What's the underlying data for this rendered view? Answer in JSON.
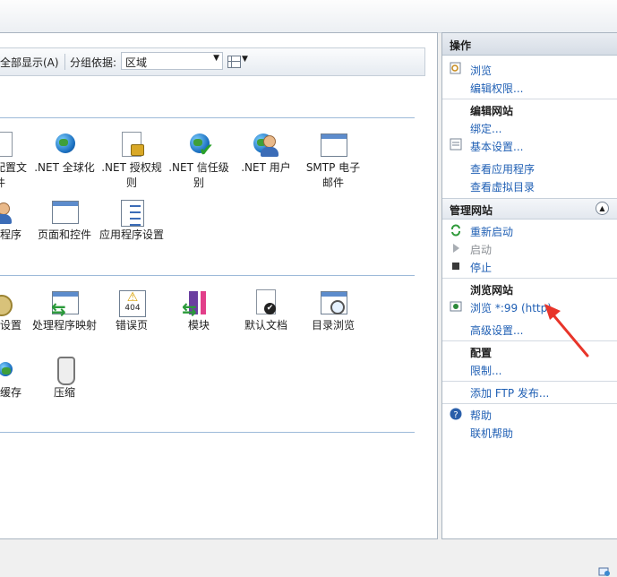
{
  "toolbar": {
    "show_all": "全部显示(A)",
    "group_by_label": "分组依据:",
    "group_by_value": "区域"
  },
  "features": [
    {
      "label": "配置文件",
      "icon": "config-file-icon"
    },
    {
      "label": ".NET 全球化",
      "icon": "globe-icon"
    },
    {
      "label": ".NET 授权规则",
      "icon": "lock-icon"
    },
    {
      "label": ".NET 信任级别",
      "icon": "trust-check-icon"
    },
    {
      "label": ".NET 用户",
      "icon": "users-icon"
    },
    {
      "label": "SMTP 电子邮件",
      "icon": "email-icon"
    },
    {
      "label": "程序",
      "icon": "user-program-icon"
    },
    {
      "label": "页面和控件",
      "icon": "pages-controls-icon"
    },
    {
      "label": "应用程序设置",
      "icon": "app-settings-icon"
    },
    {
      "label": "设置",
      "icon": "settings-icon"
    },
    {
      "label": "处理程序映射",
      "icon": "handler-mapping-icon"
    },
    {
      "label": "错误页",
      "icon": "error-page-icon"
    },
    {
      "label": "模块",
      "icon": "modules-icon"
    },
    {
      "label": "默认文档",
      "icon": "default-document-icon"
    },
    {
      "label": "目录浏览",
      "icon": "directory-browse-icon"
    },
    {
      "label": "缓存",
      "icon": "cache-icon"
    },
    {
      "label": "压缩",
      "icon": "compression-icon"
    }
  ],
  "actions": {
    "title": "操作",
    "browse": "浏览",
    "edit_permissions": "编辑权限...",
    "edit_site_heading": "编辑网站",
    "bindings": "绑定...",
    "basic_settings": "基本设置...",
    "view_applications": "查看应用程序",
    "view_virtual_dirs": "查看虚拟目录",
    "manage_site_heading": "管理网站",
    "restart": "重新启动",
    "start": "启动",
    "stop": "停止",
    "browse_site_heading": "浏览网站",
    "browse_port": "浏览 *:99 (http)",
    "advanced_settings": "高级设置...",
    "config_heading": "配置",
    "limits": "限制...",
    "add_ftp": "添加 FTP 发布...",
    "help": "帮助",
    "online_help": "联机帮助"
  },
  "colors": {
    "link": "#1f5fb4",
    "annotation_arrow": "#e8352a"
  }
}
